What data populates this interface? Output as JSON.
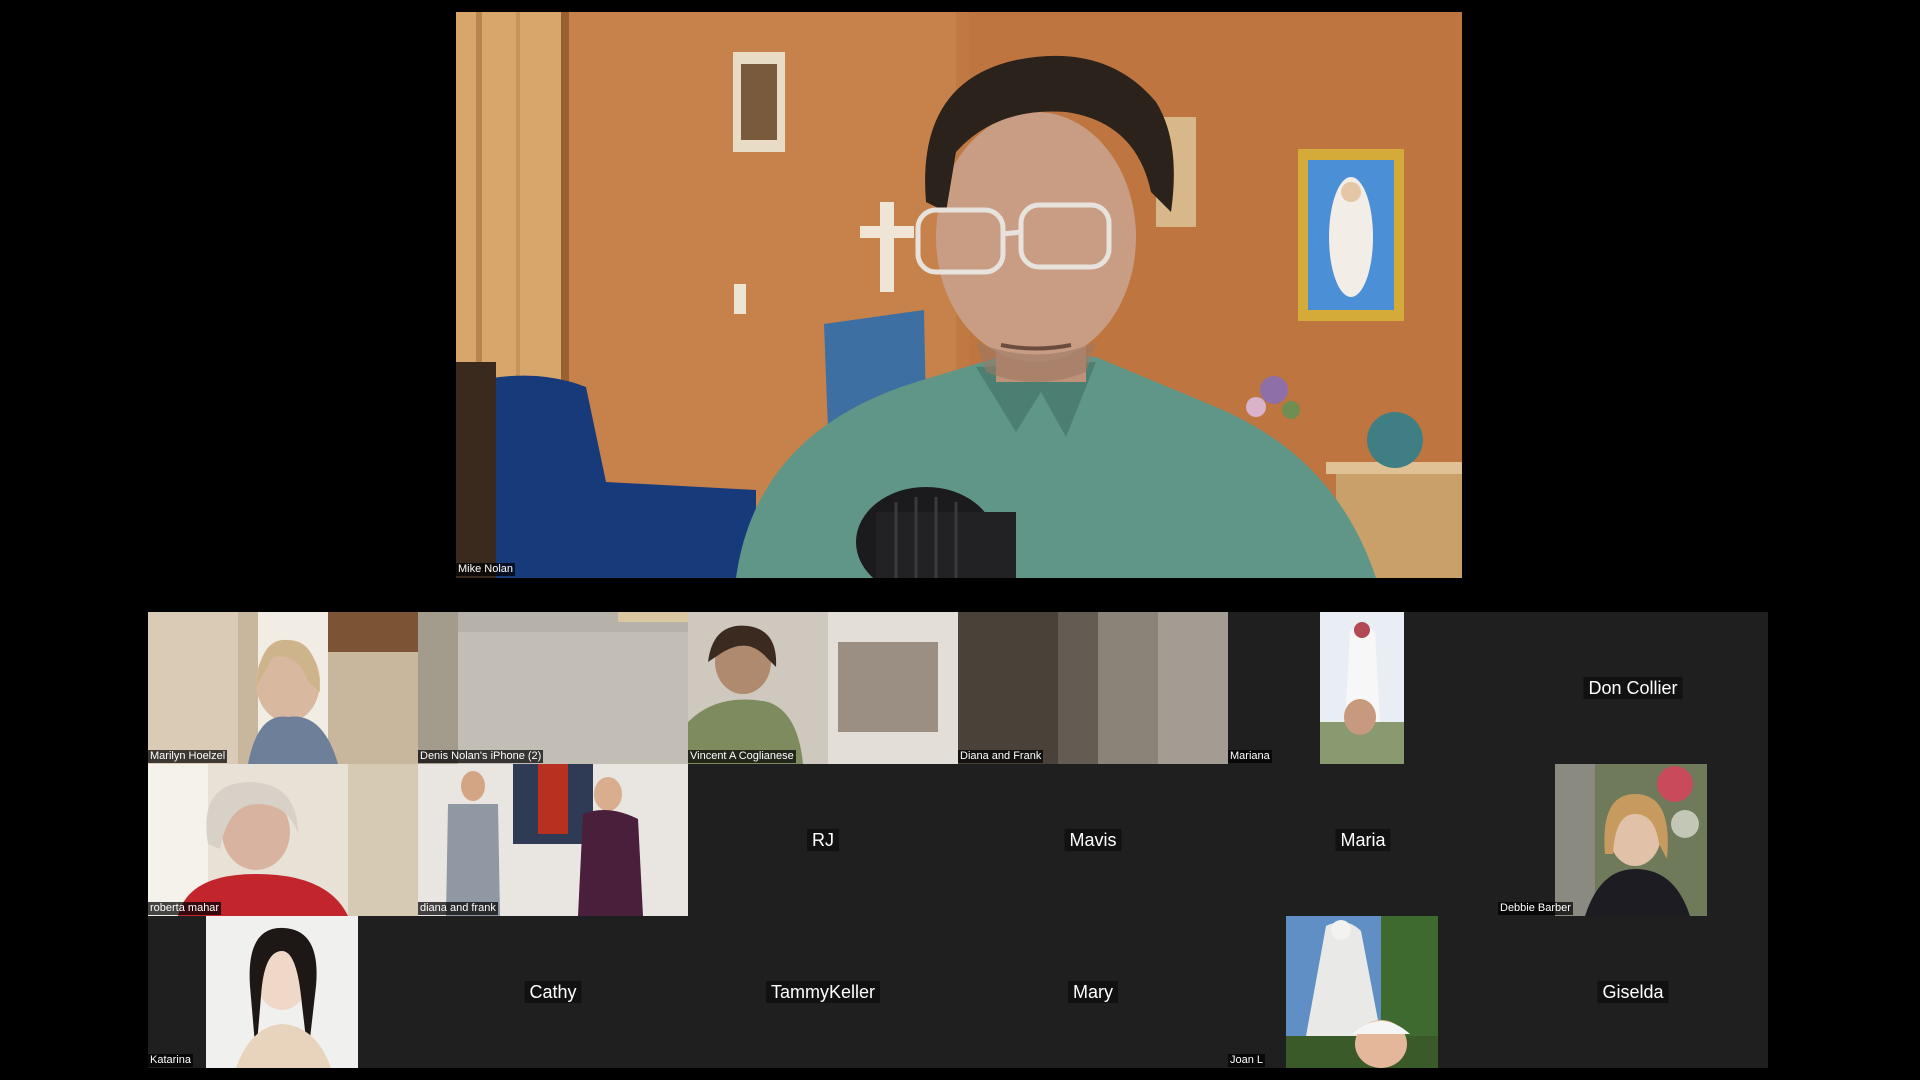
{
  "speaker": {
    "name": "Mike Nolan"
  },
  "participants": [
    {
      "name": "Marilyn Hoelzel"
    },
    {
      "name": "Denis Nolan's iPhone (2)"
    },
    {
      "name": "Vincent A Coglianese"
    },
    {
      "name": "Diana and Frank"
    },
    {
      "name": "Mariana"
    },
    {
      "name": "Don Collier"
    },
    {
      "name": "roberta mahar"
    },
    {
      "name": "diana and  frank"
    },
    {
      "name": "RJ"
    },
    {
      "name": "Mavis"
    },
    {
      "name": "Maria"
    },
    {
      "name": "Debbie Barber"
    },
    {
      "name": "Katarina"
    },
    {
      "name": "Cathy"
    },
    {
      "name": "TammyKeller"
    },
    {
      "name": "Mary"
    },
    {
      "name": "Joan L"
    },
    {
      "name": "Giselda"
    }
  ]
}
